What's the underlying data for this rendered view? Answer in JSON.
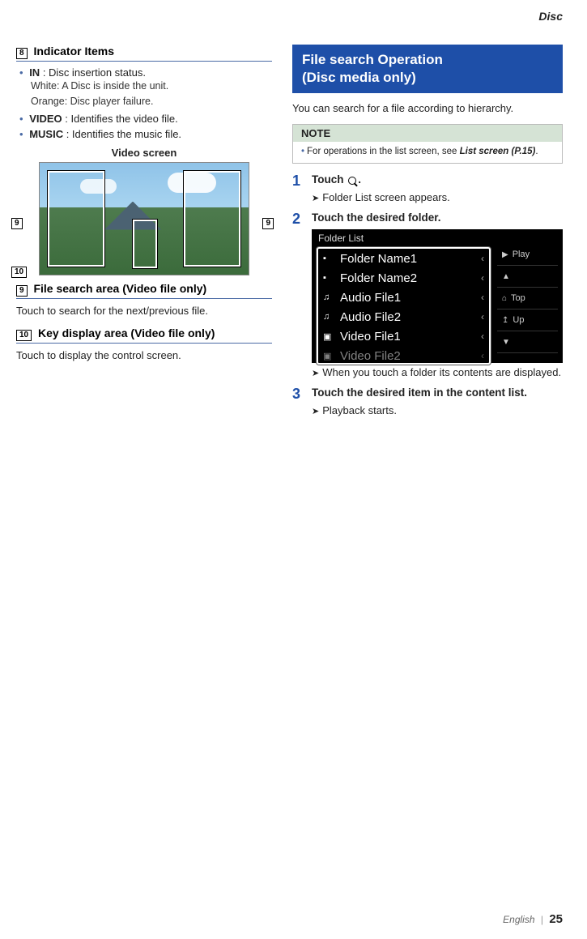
{
  "header": {
    "section": "Disc"
  },
  "left": {
    "sec8": {
      "num": "8",
      "title": "Indicator Items",
      "items": [
        {
          "term": "IN",
          "desc": ": Disc insertion status.",
          "sub1": "White: A Disc is inside the unit.",
          "sub2": "Orange: Disc player failure."
        },
        {
          "term": "VIDEO",
          "desc": ": Identifies the video file."
        },
        {
          "term": "MUSIC",
          "desc": ": Identifies the music file."
        }
      ]
    },
    "videoTitle": "Video screen",
    "callouts": {
      "c9": "9",
      "c10": "10"
    },
    "sec9": {
      "num": "9",
      "title": "File search area (Video file only)",
      "body": "Touch to search for the next/previous file."
    },
    "sec10": {
      "num": "10",
      "title": "Key display area (Video file only)",
      "body": "Touch to display the control screen."
    }
  },
  "right": {
    "heading": {
      "l1": "File search Operation",
      "l2": "(Disc media only)"
    },
    "intro": "You can search for a file according to hierarchy.",
    "note": {
      "head": "NOTE",
      "body_pre": "For operations in the list screen, see ",
      "body_ref": "List screen (P.15)",
      "body_post": "."
    },
    "step1": {
      "num": "1",
      "text_pre": "Touch ",
      "text_post": ".",
      "result": "Folder List screen appears."
    },
    "step2": {
      "num": "2",
      "text": "Touch the desired folder.",
      "result": "When you touch a folder its contents are displayed."
    },
    "step3": {
      "num": "3",
      "text": "Touch the desired item in the content list.",
      "result": "Playback starts."
    },
    "folderList": {
      "title": "Folder List",
      "items": [
        {
          "icon": "folder",
          "label": "Folder Name1"
        },
        {
          "icon": "folder",
          "label": "Folder Name2"
        },
        {
          "icon": "audio",
          "label": "Audio File1"
        },
        {
          "icon": "audio",
          "label": "Audio File2"
        },
        {
          "icon": "video",
          "label": "Video File1"
        },
        {
          "icon": "video",
          "label": "Video File2"
        }
      ],
      "side": [
        {
          "icon": "▶",
          "label": "Play"
        },
        {
          "icon": "▲",
          "label": ""
        },
        {
          "icon": "⌂",
          "label": "Top"
        },
        {
          "icon": "↥",
          "label": "Up"
        },
        {
          "icon": "▼",
          "label": ""
        }
      ]
    }
  },
  "footer": {
    "lang": "English",
    "page": "25"
  }
}
